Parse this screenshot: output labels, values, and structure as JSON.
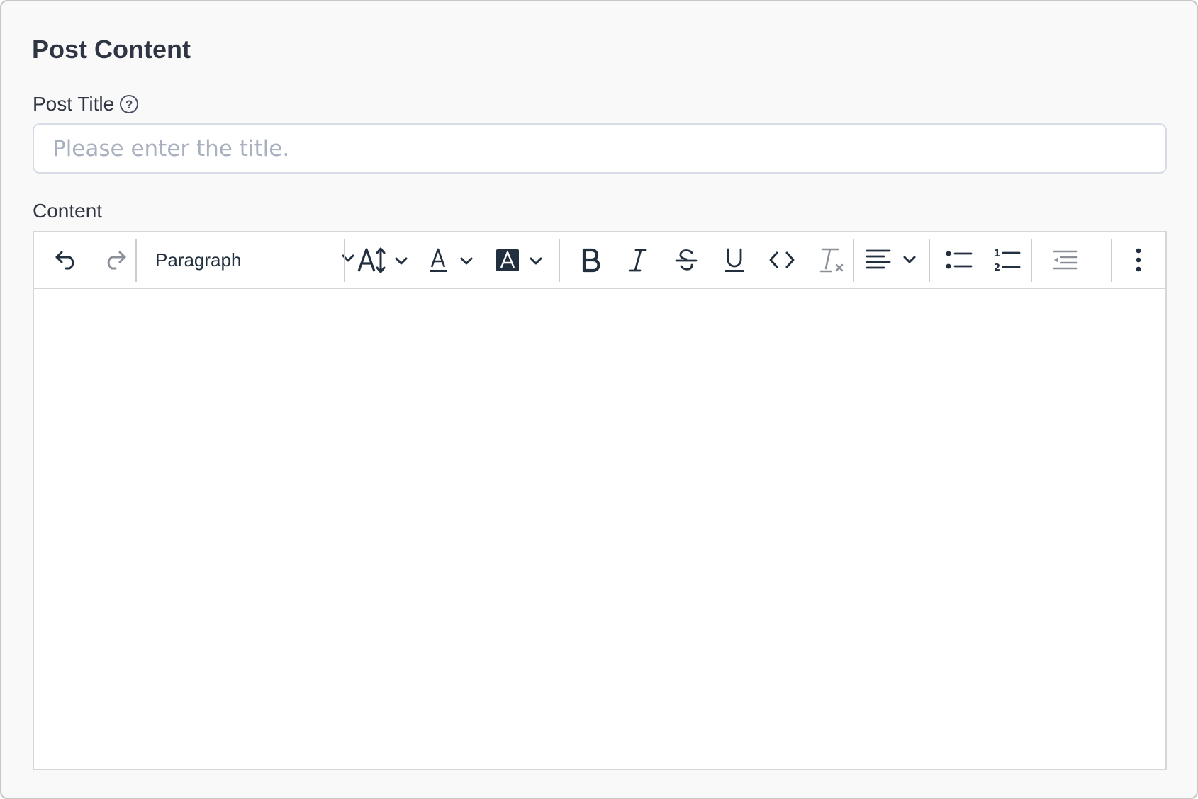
{
  "section": {
    "title": "Post Content"
  },
  "post_title": {
    "label": "Post Title",
    "help_icon": "help-circle-icon",
    "value": "",
    "placeholder": "Please enter the title."
  },
  "content": {
    "label": "Content",
    "editor": {
      "toolbar": {
        "block_format": "Paragraph",
        "buttons": [
          {
            "name": "undo",
            "icon": "undo-icon"
          },
          {
            "name": "redo",
            "icon": "redo-icon",
            "disabled": true
          },
          {
            "name": "font-size",
            "icon": "font-size-icon"
          },
          {
            "name": "text-color",
            "icon": "text-color-icon"
          },
          {
            "name": "background-color",
            "icon": "highlight-color-icon"
          },
          {
            "name": "bold",
            "icon": "bold-icon"
          },
          {
            "name": "italic",
            "icon": "italic-icon"
          },
          {
            "name": "strikethrough",
            "icon": "strikethrough-icon"
          },
          {
            "name": "underline",
            "icon": "underline-icon"
          },
          {
            "name": "code",
            "icon": "code-icon"
          },
          {
            "name": "clear-formatting",
            "icon": "remove-format-icon",
            "disabled": true
          },
          {
            "name": "align",
            "icon": "align-left-icon"
          },
          {
            "name": "bullet-list",
            "icon": "bullet-list-icon"
          },
          {
            "name": "numbered-list",
            "icon": "numbered-list-icon"
          },
          {
            "name": "outdent",
            "icon": "outdent-icon",
            "disabled": true
          },
          {
            "name": "more",
            "icon": "more-vertical-icon"
          }
        ]
      },
      "body": ""
    }
  },
  "colors": {
    "panel_bg": "#f9f9fa",
    "text": "#2f3542",
    "placeholder": "#a9b1c1",
    "icon": "#222f3e",
    "icon_disabled": "#8a8f98"
  }
}
